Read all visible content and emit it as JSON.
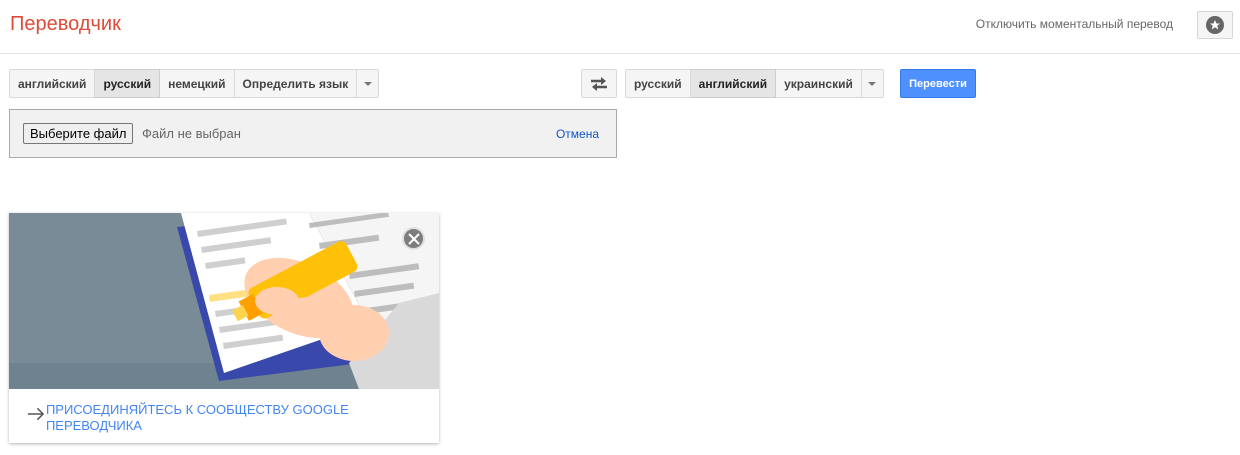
{
  "header": {
    "title": "Переводчик",
    "instant_toggle": "Отключить моментальный перевод",
    "starred_icon": "star-icon"
  },
  "source_langs": {
    "items": [
      "английский",
      "русский",
      "немецкий",
      "Определить язык"
    ],
    "selected": "русский"
  },
  "target_langs": {
    "items": [
      "русский",
      "английский",
      "украинский"
    ],
    "selected": "английский"
  },
  "swap_icon": "swap-languages-icon",
  "translate_button": "Перевести",
  "file_input": {
    "button": "Выберите файл",
    "status": "Файл не выбран",
    "cancel": "Отмена"
  },
  "promo": {
    "link_text": "ПРИСОЕДИНЯЙТЕСЬ К СООБЩЕСТВУ GOOGLE ПЕРЕВОДЧИКА",
    "illustration": "hand-highlighting-book",
    "colors": {
      "background": "#7a8d99",
      "book": "#3949ab",
      "highlighter": "#ffc107",
      "link": "#4285f4"
    }
  },
  "colors": {
    "title": "#dd4b39",
    "primary_button": "#4d90fe"
  }
}
